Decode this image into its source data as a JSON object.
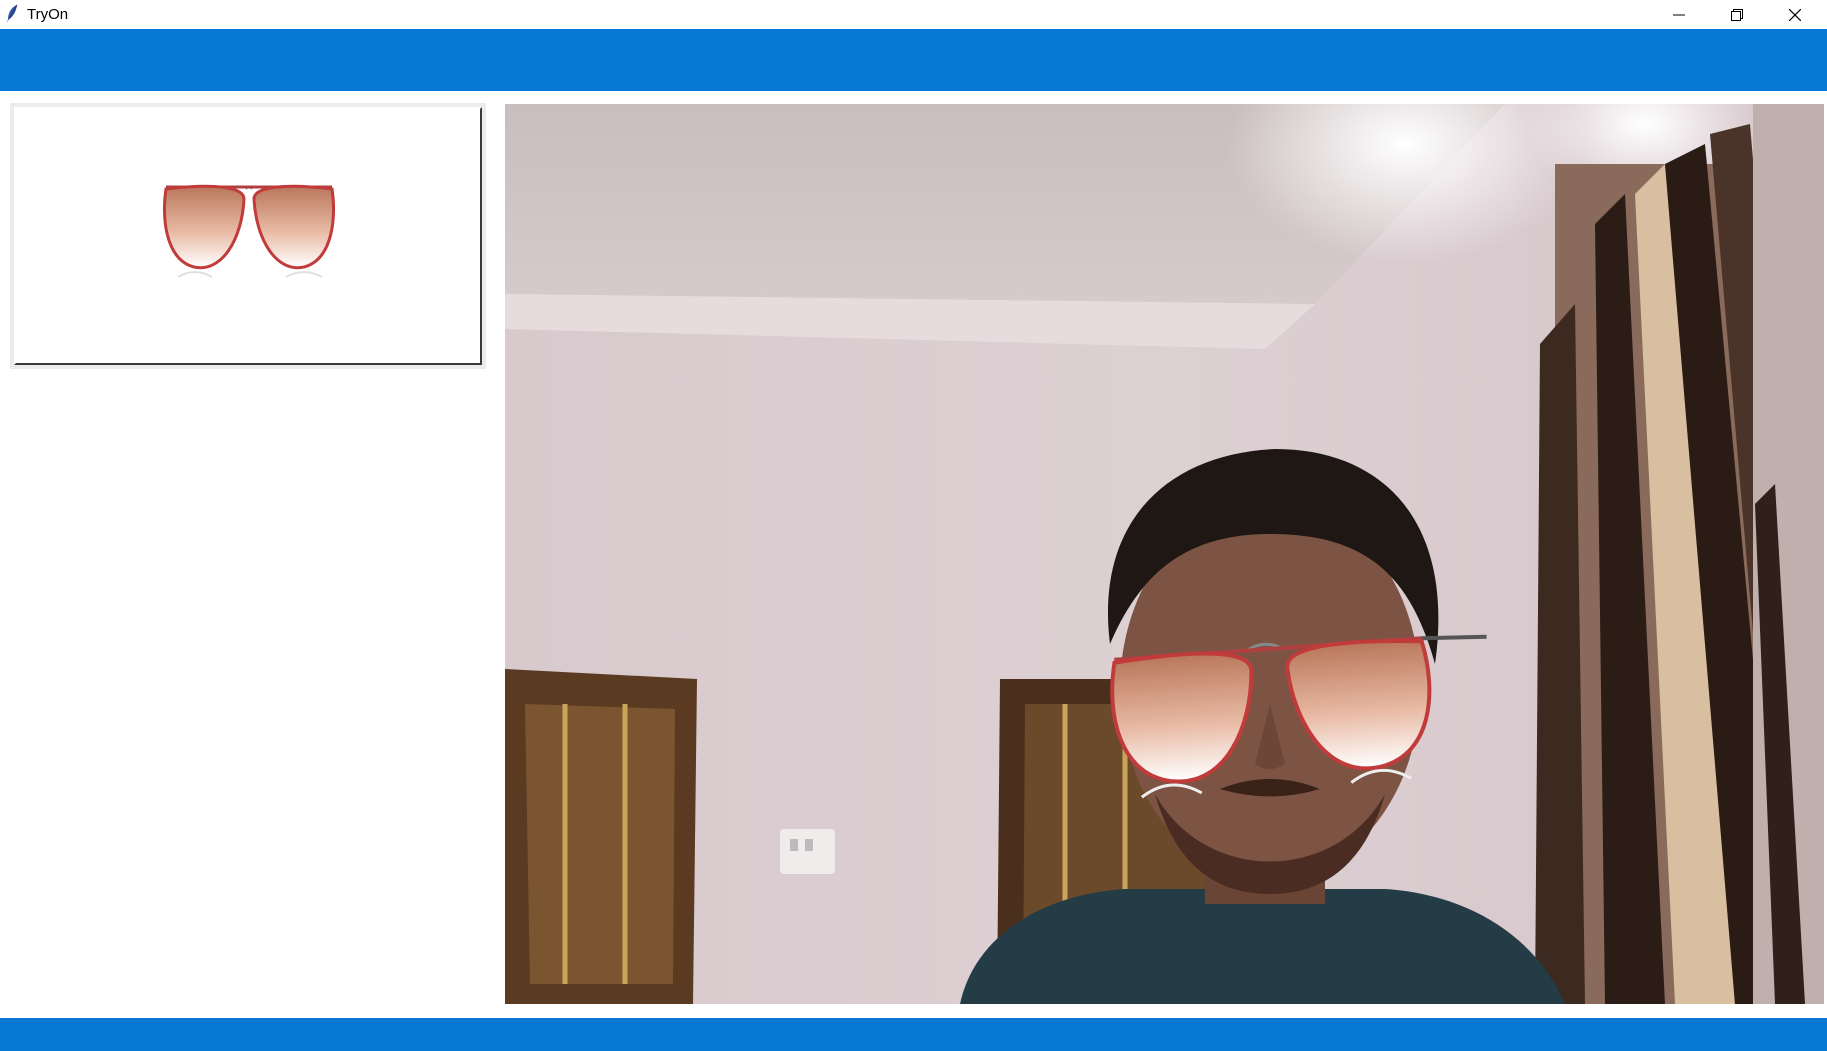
{
  "window": {
    "title": "TryOn",
    "app_icon": "feather-icon",
    "controls": [
      "minimize-icon",
      "restore-icon",
      "close-icon"
    ]
  },
  "colors": {
    "accent_band": "#0778d4",
    "frame_red": "#c23b3b"
  },
  "selected_item": {
    "icon": "aviator-sunglasses-icon"
  },
  "camera": {
    "overlay_icon": "aviator-sunglasses-icon"
  }
}
